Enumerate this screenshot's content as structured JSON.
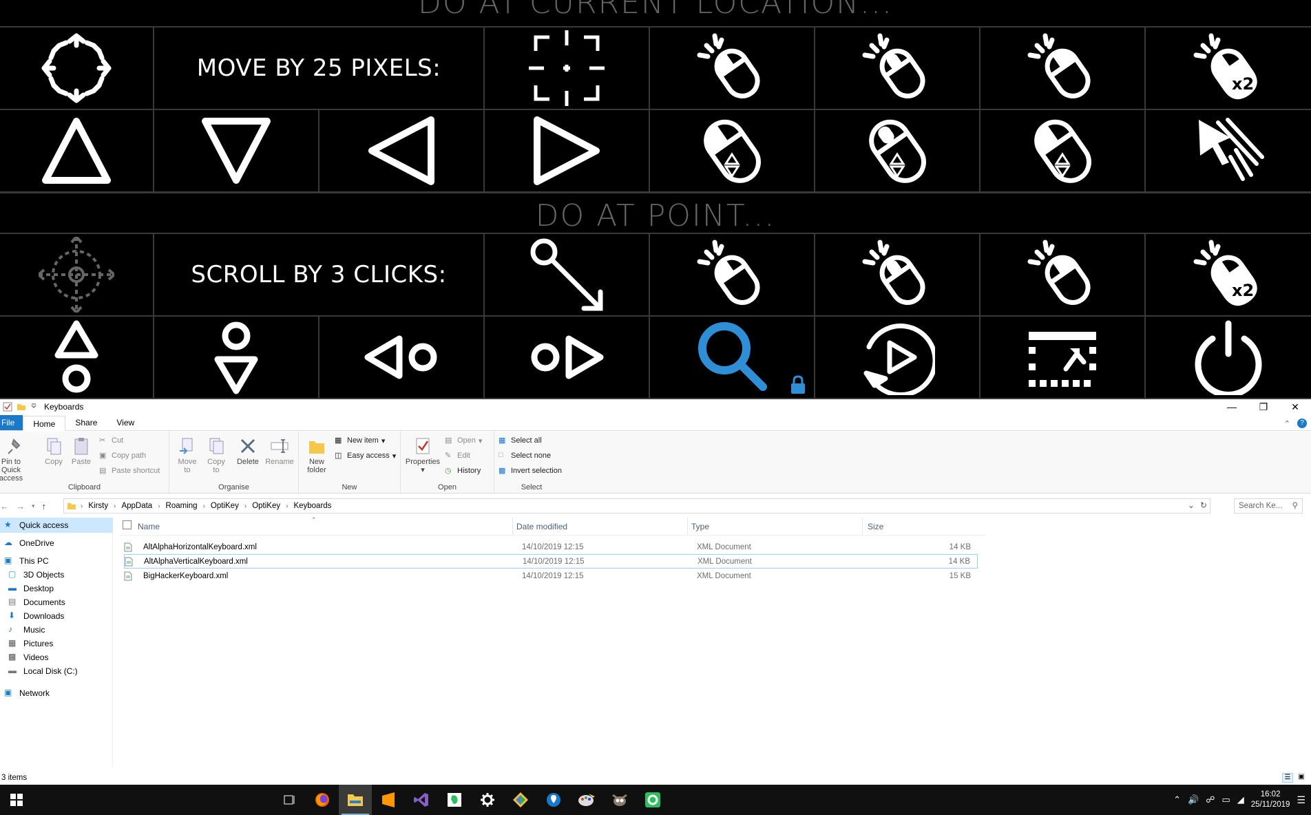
{
  "keyboard": {
    "band_top": "DO AT CURRENT LOCATION...",
    "band_mid": "DO AT POINT...",
    "move_label": "MOVE BY 25 PIXELS:",
    "scroll_label": "SCROLL BY 3 CLICKS:",
    "double_click_badge": "x2"
  },
  "explorer": {
    "title": "Keyboards",
    "tabs": [
      "File",
      "Home",
      "Share",
      "View"
    ],
    "clipboard": {
      "pin": "Pin to Quick access",
      "copy": "Copy",
      "paste": "Paste",
      "cut": "Cut",
      "copy_path": "Copy path",
      "paste_shortcut": "Paste shortcut",
      "group": "Clipboard"
    },
    "organise": {
      "move_to": "Move to",
      "copy_to": "Copy to",
      "delete": "Delete",
      "rename": "Rename",
      "group": "Organise"
    },
    "new": {
      "new_folder": "New folder",
      "new_item": "New item",
      "easy_access": "Easy access",
      "group": "New"
    },
    "open": {
      "properties": "Properties",
      "open": "Open",
      "edit": "Edit",
      "history": "History",
      "group": "Open"
    },
    "select": {
      "select_all": "Select all",
      "select_none": "Select none",
      "invert": "Invert selection",
      "group": "Select"
    },
    "breadcrumb": [
      "Kirsty",
      "AppData",
      "Roaming",
      "OptiKey",
      "OptiKey",
      "Keyboards"
    ],
    "search_placeholder": "Search Ke...",
    "nav": [
      "Quick access",
      "OneDrive",
      "This PC",
      "3D Objects",
      "Desktop",
      "Documents",
      "Downloads",
      "Music",
      "Pictures",
      "Videos",
      "Local Disk (C:)",
      "Network"
    ],
    "columns": [
      "Name",
      "Date modified",
      "Type",
      "Size"
    ],
    "files": [
      {
        "name": "AltAlphaHorizontalKeyboard.xml",
        "date": "14/10/2019 12:15",
        "type": "XML Document",
        "size": "14 KB"
      },
      {
        "name": "AltAlphaVerticalKeyboard.xml",
        "date": "14/10/2019 12:15",
        "type": "XML Document",
        "size": "14 KB"
      },
      {
        "name": "BigHackerKeyboard.xml",
        "date": "14/10/2019 12:15",
        "type": "XML Document",
        "size": "15 KB"
      }
    ],
    "status": "3 items"
  },
  "taskbar": {
    "time": "16:02",
    "date": "25/11/2019"
  },
  "colors": {
    "lock_blue": "#2e8fd6",
    "file_tab": "#1979ca",
    "selection": "#cce8ff"
  }
}
